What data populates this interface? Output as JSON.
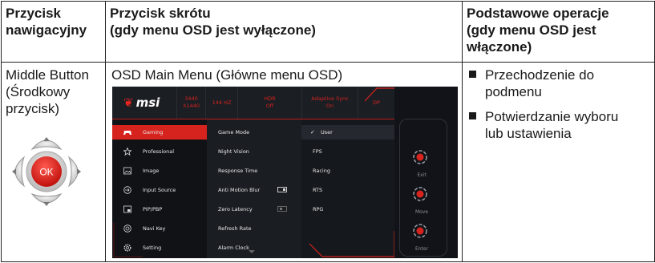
{
  "header": {
    "col1": [
      "Przycisk",
      "nawigacyjny"
    ],
    "col2": [
      "Przycisk skrótu",
      "(gdy menu OSD jest wyłączone)"
    ],
    "col3": [
      "Podstawowe operacje",
      "(gdy menu OSD jest",
      "włączone)"
    ]
  },
  "row": {
    "button_name": [
      "Middle Button",
      "(Środkowy",
      "przycisk)"
    ],
    "ok_label": "OK",
    "shortcut": "OSD Main Menu (Główne menu OSD)",
    "operations": [
      [
        "Przechodzenie do",
        "podmenu"
      ],
      [
        "Potwierdzanie wyboru",
        "lub ustawienia"
      ]
    ]
  },
  "osd": {
    "brand": "msi",
    "status": [
      "3440 X1440",
      "144 HZ",
      "HDR",
      "Off",
      "Adaptive Sync",
      "On",
      "DP"
    ],
    "menu": [
      "Gaming",
      "Professional",
      "Image",
      "Input Source",
      "PIP/PBP",
      "Navi Key",
      "Setting"
    ],
    "submenu": [
      "Game Mode",
      "Night Vision",
      "Response Time",
      "Anti Motion Blur",
      "Zero Latency",
      "Refresh Rate",
      "Alarm Clock"
    ],
    "options": [
      "User",
      "FPS",
      "Racing",
      "RTS",
      "RPG"
    ],
    "controls": [
      "Exit",
      "Move",
      "Enter"
    ],
    "accent": "#d7231e",
    "icons": [
      "gamepad-icon",
      "star-icon",
      "image-icon",
      "input-source-icon",
      "pip-pbp-icon",
      "navi-key-icon",
      "gear-icon"
    ]
  }
}
